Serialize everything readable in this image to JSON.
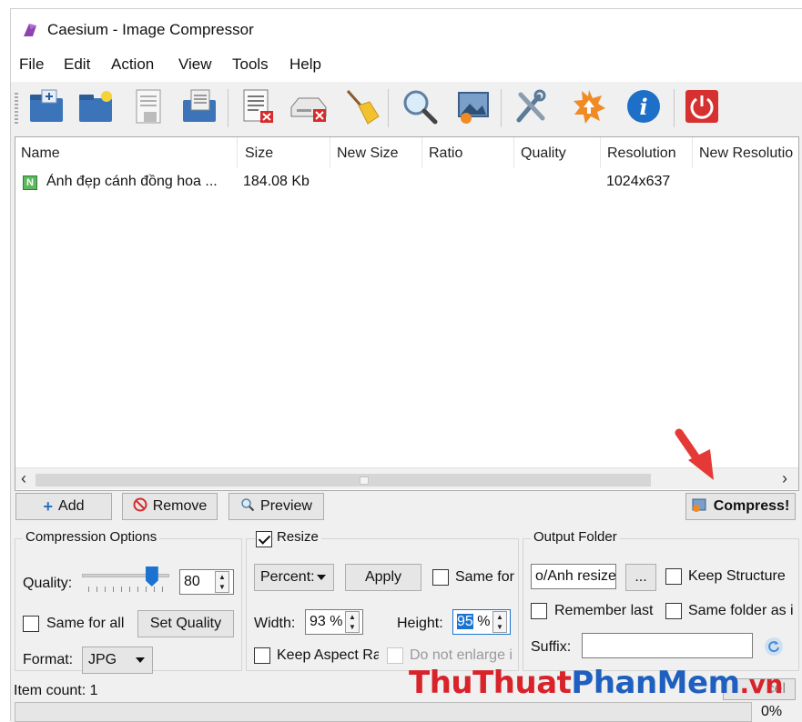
{
  "window": {
    "title": "Caesium - Image Compressor"
  },
  "menu": [
    "File",
    "Edit",
    "Action",
    "View",
    "Tools",
    "Help"
  ],
  "toolbar_icons": [
    "open-files-icon",
    "open-folder-icon",
    "save-list-icon",
    "export-icon",
    "remove-items-icon",
    "clear-list-icon",
    "clean-icon",
    "search-icon",
    "preview-image-icon",
    "settings-tools-icon",
    "update-icon",
    "info-icon",
    "exit-icon"
  ],
  "file_list": {
    "columns": [
      "Name",
      "Size",
      "New Size",
      "Ratio",
      "Quality",
      "Resolution",
      "New Resolutio"
    ],
    "rows": [
      {
        "icon": "N",
        "name": "Ảnh đẹp cánh đồng hoa ...",
        "size": "184.08 Kb",
        "new_size": "",
        "ratio": "",
        "quality": "",
        "resolution": "1024x637",
        "new_resolution": ""
      }
    ]
  },
  "actions": {
    "add": "Add",
    "remove": "Remove",
    "preview": "Preview",
    "compress": "Compress!"
  },
  "compression": {
    "title": "Compression Options",
    "quality_label": "Quality:",
    "quality_value": "80",
    "quality_slider_fraction": 0.8,
    "same_for_all": "Same for all",
    "set_quality": "Set Quality",
    "format_label": "Format:",
    "format_value": "JPG"
  },
  "resize": {
    "title": "Resize",
    "checked": true,
    "mode": "Percent:",
    "apply": "Apply",
    "same_for": "Same for",
    "width_label": "Width:",
    "width_value": "93 %",
    "height_label": "Height:",
    "height_value": "95",
    "height_unit": "%",
    "keep_aspect": "Keep Aspect Ra",
    "do_not_enlarge": "Do not enlarge i"
  },
  "output": {
    "title": "Output Folder",
    "folder_value": "o/Anh resize",
    "browse": "...",
    "keep_structure": "Keep Structure",
    "remember_last": "Remember last f",
    "same_folder": "Same folder as i",
    "suffix_label": "Suffix:",
    "suffix_value": ""
  },
  "status": {
    "item_count": "Item count: 1",
    "cancel": "cel",
    "progress": "0%"
  },
  "watermark": {
    "part1": "ThuThuat",
    "part2": "PhanMem",
    "part3": ".vn"
  },
  "colors": {
    "accent": "#1a73d1",
    "annotation_arrow": "#e53935"
  }
}
